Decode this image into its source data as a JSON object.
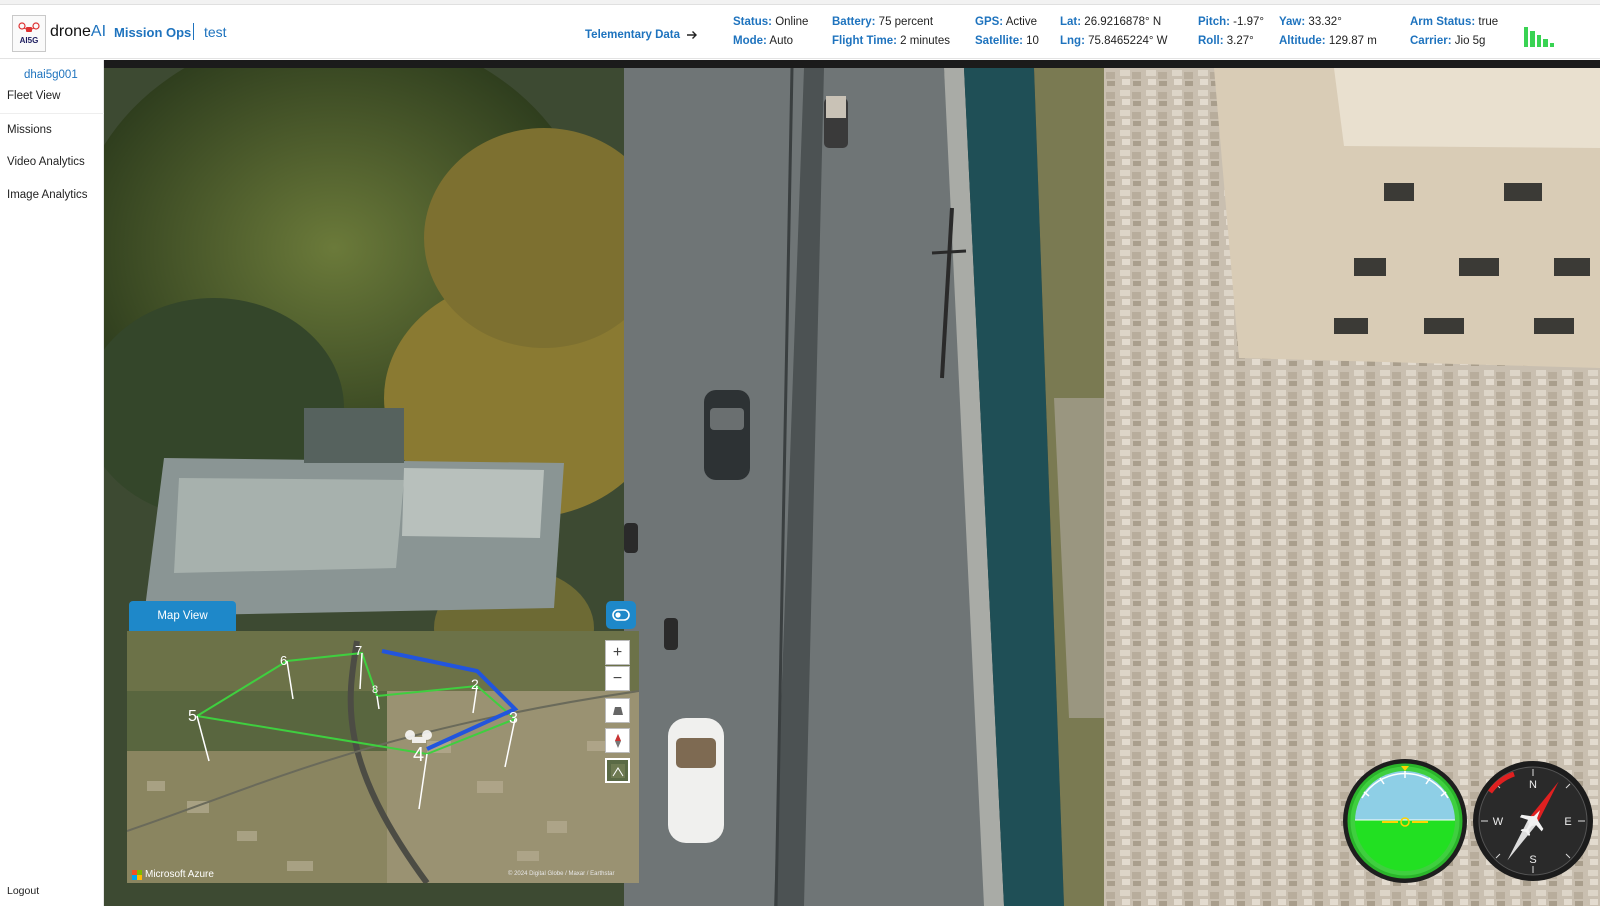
{
  "brand": {
    "name_prefix": "drone",
    "name_suffix": "AI",
    "subtitle": "Mission Ops",
    "environment": "test",
    "logo_text": "AI5G"
  },
  "header": {
    "telemetry_link": "Telementary Data",
    "stats": [
      {
        "key": "Status:",
        "value": "Online"
      },
      {
        "key": "Mode:",
        "value": "Auto"
      },
      {
        "key": "Battery:",
        "value": "75 percent"
      },
      {
        "key": "Flight Time:",
        "value": "2 minutes"
      },
      {
        "key": "GPS:",
        "value": "Active"
      },
      {
        "key": "Satellite:",
        "value": "10"
      },
      {
        "key": "Lat:",
        "value": "26.9216878° N"
      },
      {
        "key": "Lng:",
        "value": "75.8465224° W"
      },
      {
        "key": "Pitch:",
        "value": "-1.97°"
      },
      {
        "key": "Roll:",
        "value": "3.27°"
      },
      {
        "key": "Yaw:",
        "value": "33.32°"
      },
      {
        "key": "Altitude:",
        "value": "129.87 m"
      },
      {
        "key": "Arm Status:",
        "value": "true"
      },
      {
        "key": "Carrier:",
        "value": "Jio 5g"
      }
    ]
  },
  "sidebar": {
    "drone_id": "dhai5g001",
    "items": [
      {
        "label": "Fleet View"
      },
      {
        "label": "Missions"
      },
      {
        "label": "Video Analytics"
      },
      {
        "label": "Image Analytics"
      }
    ],
    "logout": "Logout"
  },
  "map": {
    "tab_label": "Map View",
    "controls": {
      "zoom_in": "+",
      "zoom_out": "−"
    },
    "waypoints": [
      "2",
      "3",
      "4",
      "5",
      "6",
      "7",
      "8"
    ],
    "attribution": "Microsoft Azure",
    "copyright": "© 2024 Digital Globe / Maxar / Earthstar"
  },
  "colors": {
    "accent": "#1e73be",
    "route_planned": "#3fcf3f",
    "route_flown": "#2255dd",
    "signal": "#39d353"
  }
}
